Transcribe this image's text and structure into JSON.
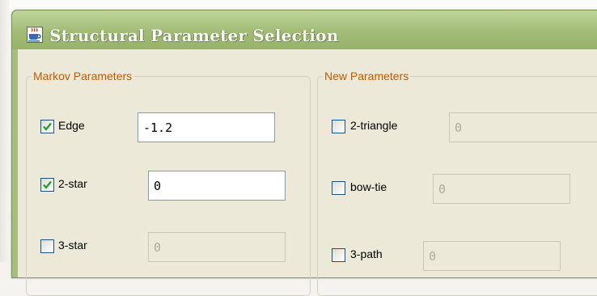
{
  "window": {
    "title": "Structural Parameter Selection",
    "icon": "java-cup-icon",
    "accent": "#a5be7d"
  },
  "markov_group": {
    "title": "Markov Parameters",
    "params": [
      {
        "label": "Edge",
        "checked": true,
        "value": "-1.2",
        "enabled": true
      },
      {
        "label": "2-star",
        "checked": true,
        "value": "0",
        "enabled": true
      },
      {
        "label": "3-star",
        "checked": false,
        "value": "0",
        "enabled": false
      }
    ]
  },
  "new_group": {
    "title": "New Parameters",
    "params": [
      {
        "label": "2-triangle",
        "checked": false,
        "value": "0",
        "enabled": false
      },
      {
        "label": "bow-tie",
        "checked": false,
        "value": "0",
        "enabled": false
      },
      {
        "label": "3-path",
        "checked": false,
        "value": "0",
        "enabled": false
      }
    ]
  },
  "colors": {
    "group_title": "#c25a00",
    "checkbox_border": "#1c5180",
    "checkmark": "#21a121"
  }
}
